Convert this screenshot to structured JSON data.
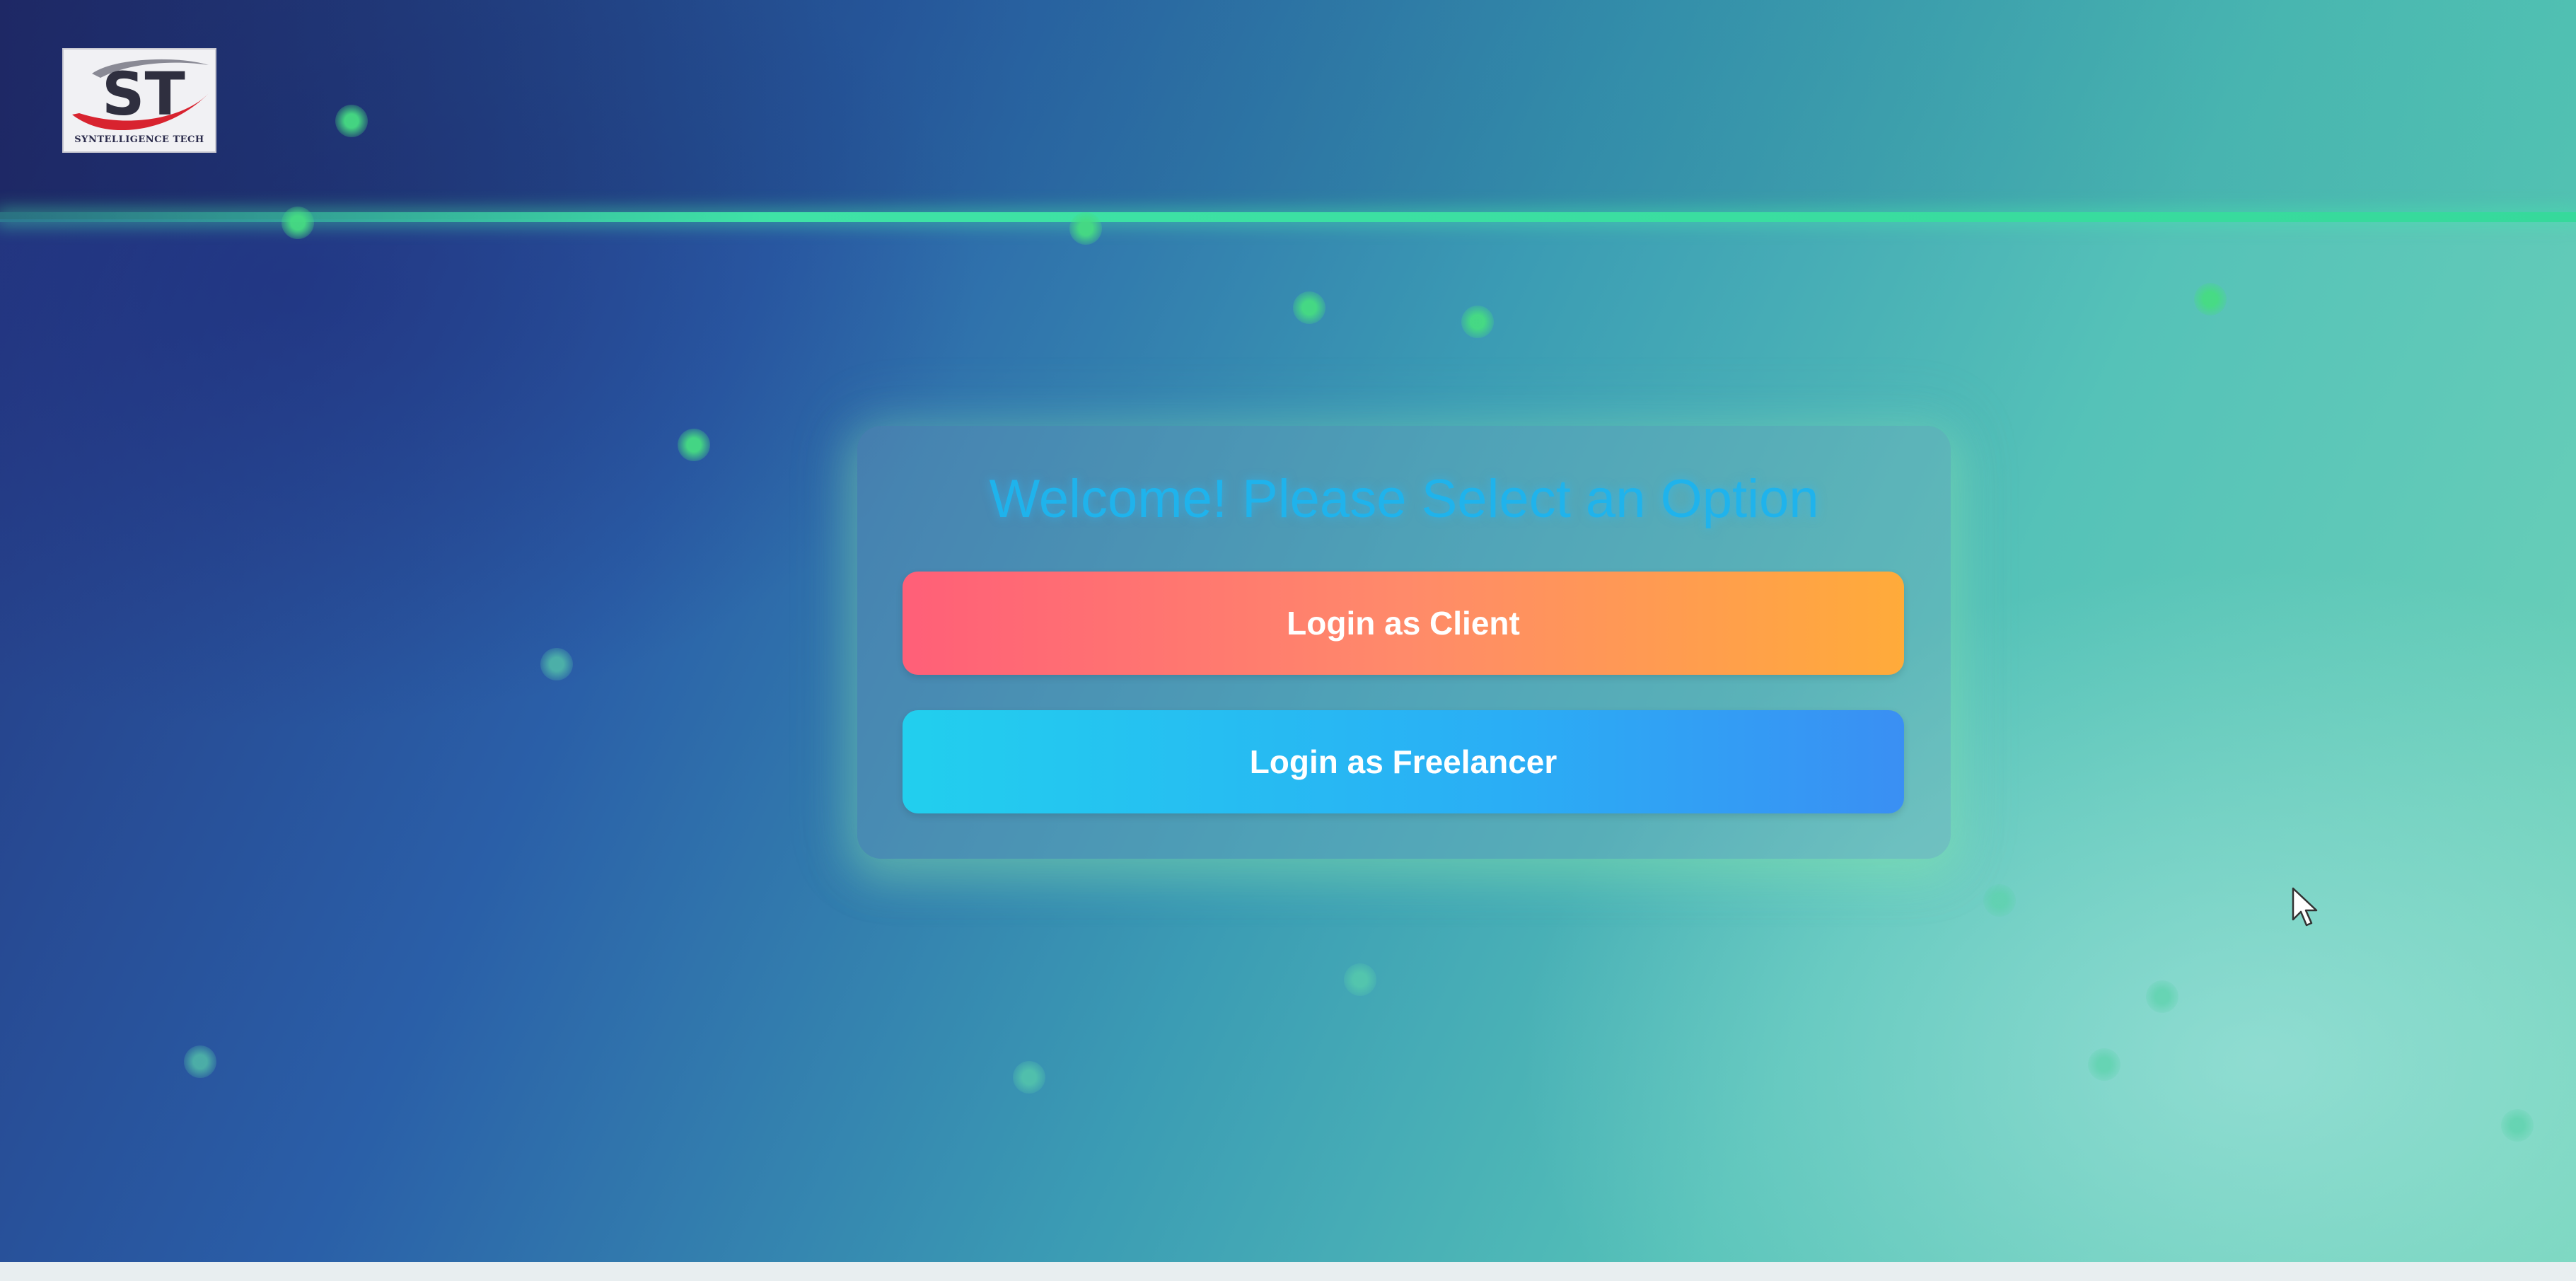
{
  "logo": {
    "monogram": "ST",
    "company": "SYNTELLIGENCE TECH"
  },
  "card": {
    "title": "Welcome! Please Select an Option",
    "client_button_label": "Login as Client",
    "freelancer_button_label": "Login as Freelancer"
  },
  "colors": {
    "title": "#1fb3ec",
    "client_button_start": "#ff5f78",
    "client_button_end": "#ffab3a",
    "freelancer_button_start": "#22cfee",
    "freelancer_button_end": "#3a8ff3",
    "dots": "#46dc82"
  },
  "icons": [
    "mouse-pointer-icon"
  ]
}
